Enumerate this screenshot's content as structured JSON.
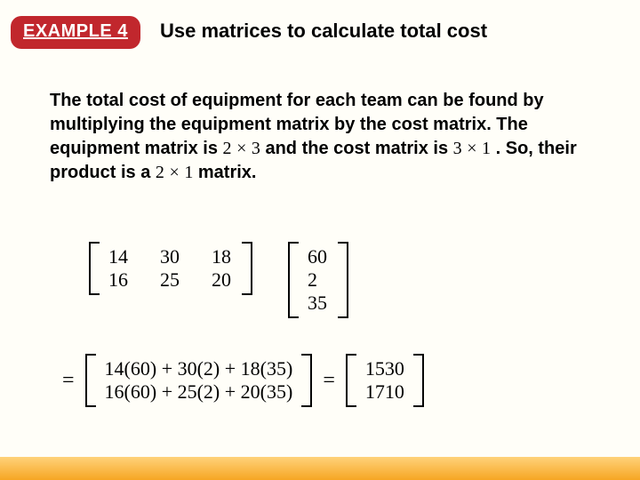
{
  "badge": "EXAMPLE 4",
  "title": "Use matrices to calculate total cost",
  "body": {
    "p1": "The total cost of equipment for each team can be found by multiplying the equipment matrix by the cost matrix. The equipment matrix is ",
    "dim1_a": "2",
    "times1": "×",
    "dim1_b": "3",
    "p2": " and the cost matrix is ",
    "dim2_a": "3",
    "times2": "×",
    "dim2_b": "1",
    "p3": ". So, their product is a ",
    "dim3_a": "2",
    "times3": "×",
    "dim3_b": "1",
    "p4": " matrix."
  },
  "matrixA": [
    [
      "14",
      "30",
      "18"
    ],
    [
      "16",
      "25",
      "20"
    ]
  ],
  "matrixB": [
    [
      "60"
    ],
    [
      "2"
    ],
    [
      "35"
    ]
  ],
  "calc": {
    "eq1": "=",
    "row1": "14(60) + 30(2) + 18(35)",
    "row2": "16(60) + 25(2) + 20(35)",
    "eq2": "=",
    "res1": "1530",
    "res2": "1710"
  },
  "chart_data": {
    "type": "table",
    "title": "Matrix multiplication for total equipment cost",
    "matrices": {
      "equipment": {
        "rows": 2,
        "cols": 3,
        "values": [
          [
            14,
            30,
            18
          ],
          [
            16,
            25,
            20
          ]
        ]
      },
      "cost": {
        "rows": 3,
        "cols": 1,
        "values": [
          [
            60
          ],
          [
            2
          ],
          [
            35
          ]
        ]
      },
      "product": {
        "rows": 2,
        "cols": 1,
        "values": [
          [
            1530
          ],
          [
            1710
          ]
        ]
      }
    }
  }
}
